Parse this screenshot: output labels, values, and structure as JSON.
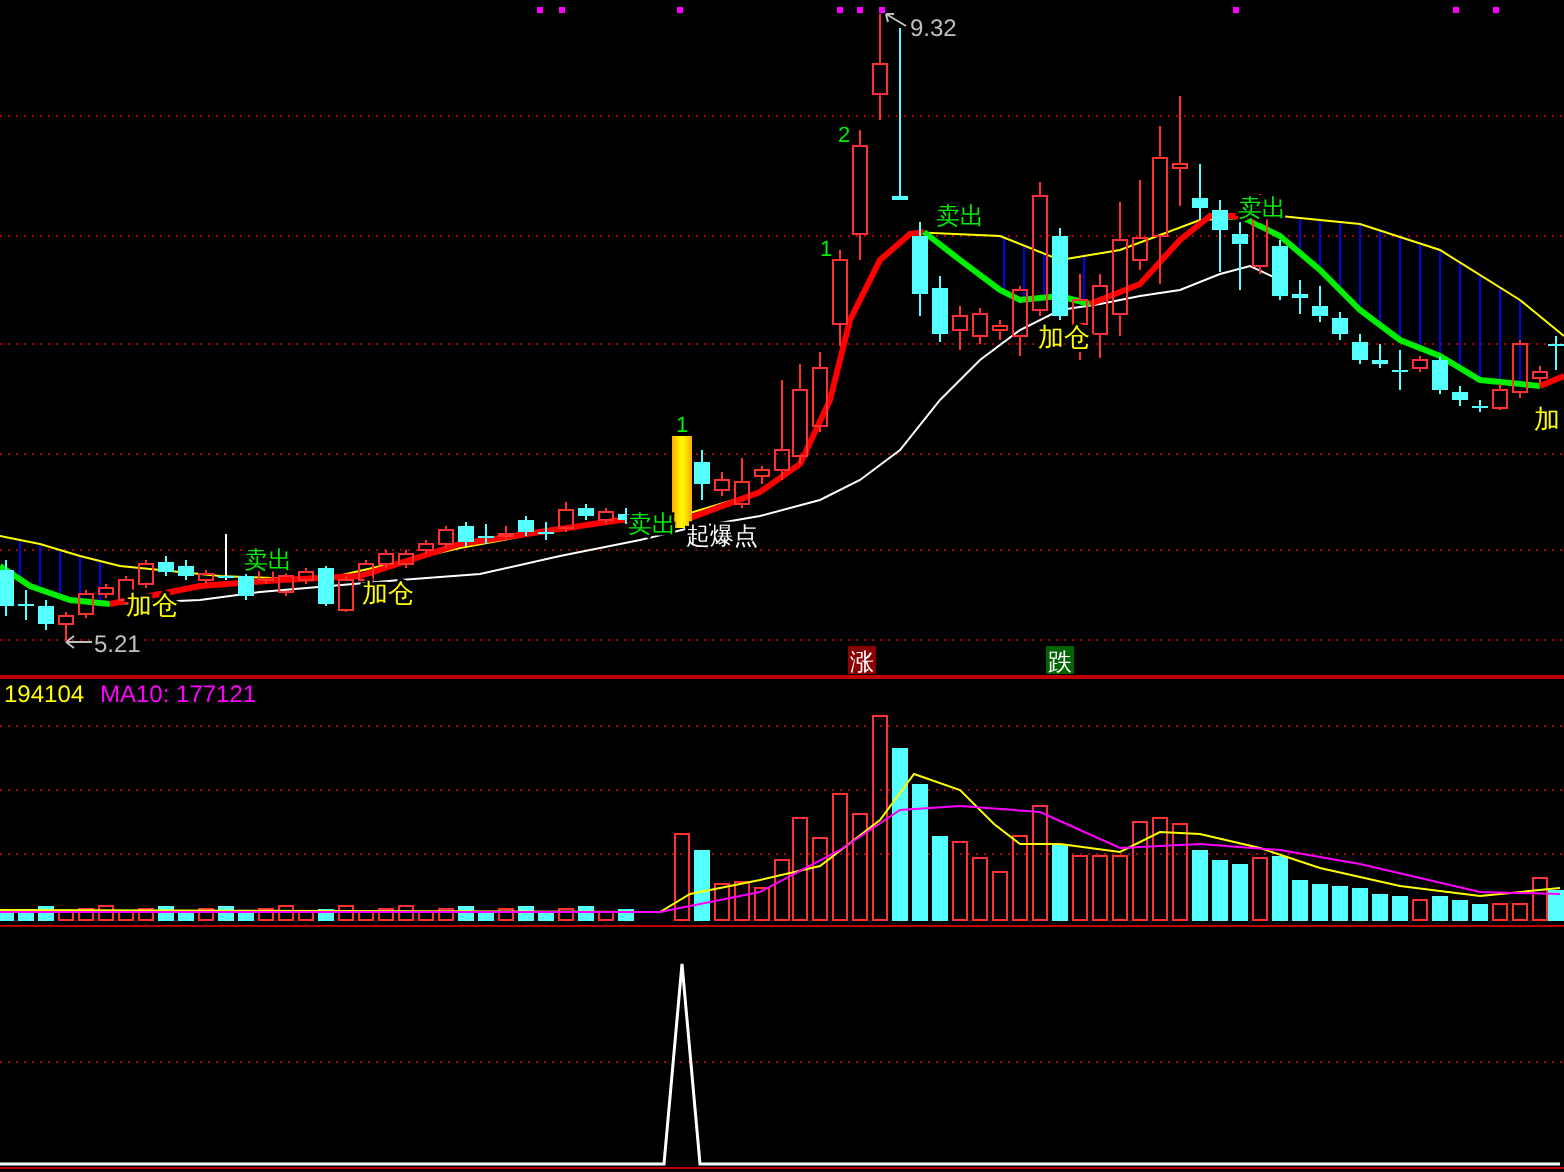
{
  "price_panel": {
    "high_price": "9.32",
    "low_price": "5.21",
    "wave_labels": [
      "1",
      "1",
      "2"
    ],
    "sell_signals": [
      "卖出",
      "卖出",
      "卖出",
      "卖出"
    ],
    "add_signals": [
      "加仓",
      "加仓",
      "加仓",
      "加"
    ],
    "breakout_label": "起爆点",
    "tags": [
      {
        "kind": "up",
        "text": "涨"
      },
      {
        "kind": "down",
        "text": "跌"
      }
    ]
  },
  "volume_panel": {
    "volume": "194104",
    "ma10": "MA10: 177121"
  }
}
